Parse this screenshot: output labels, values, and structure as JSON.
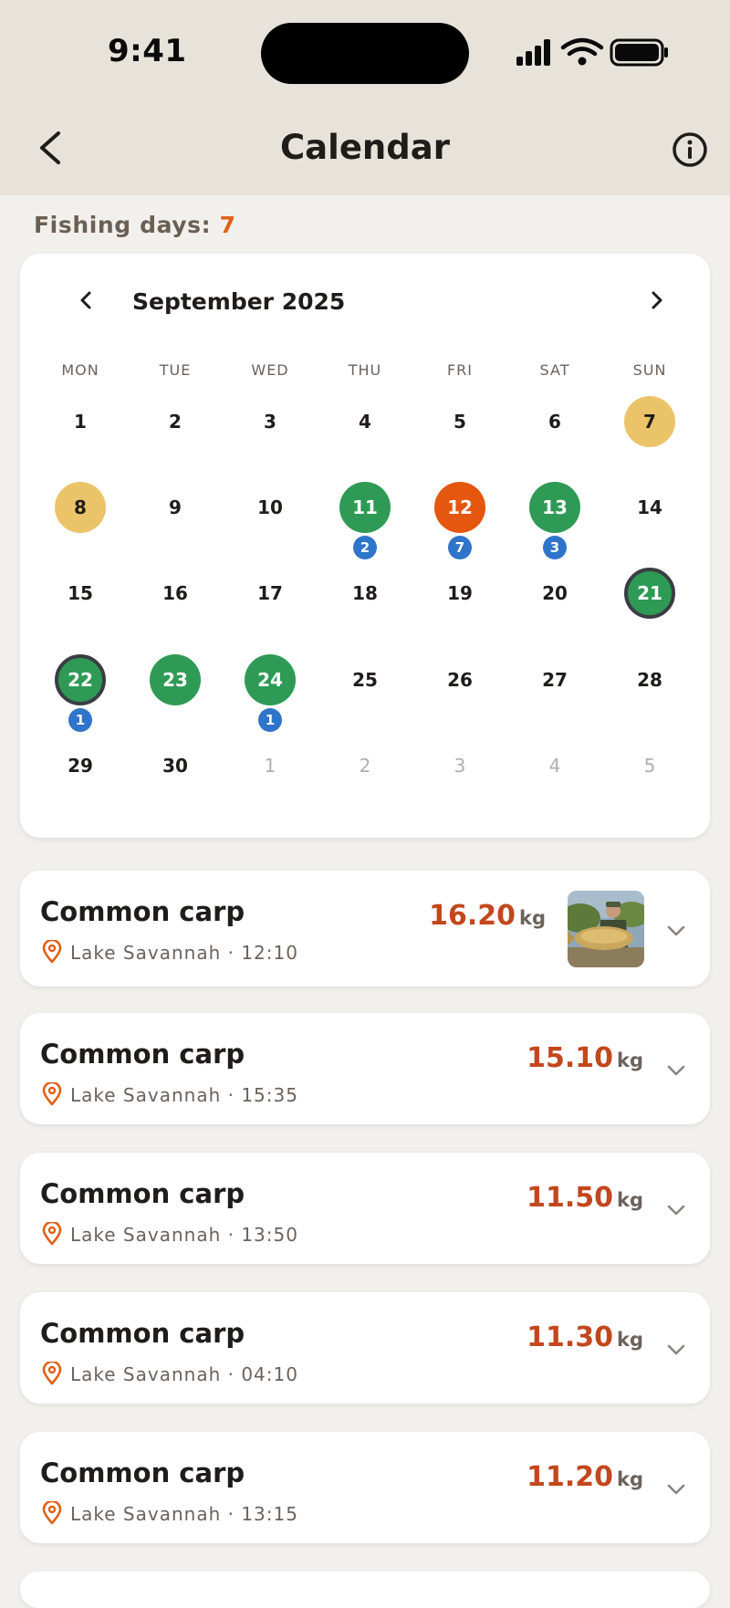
{
  "status": {
    "time": "9:41"
  },
  "nav": {
    "title": "Calendar"
  },
  "fishing_days": {
    "label": "Fishing days:",
    "count": "7"
  },
  "calendar": {
    "month_label": "September 2025",
    "weekdays": [
      "MON",
      "TUE",
      "WED",
      "THU",
      "FRI",
      "SAT",
      "SUN"
    ],
    "weeks": [
      [
        {
          "d": "1"
        },
        {
          "d": "2"
        },
        {
          "d": "3"
        },
        {
          "d": "4"
        },
        {
          "d": "5"
        },
        {
          "d": "6"
        },
        {
          "d": "7",
          "state": "yellow"
        }
      ],
      [
        {
          "d": "8",
          "state": "yellow"
        },
        {
          "d": "9"
        },
        {
          "d": "10"
        },
        {
          "d": "11",
          "state": "green",
          "badge": "2"
        },
        {
          "d": "12",
          "state": "orange",
          "badge": "7"
        },
        {
          "d": "13",
          "state": "green",
          "badge": "3"
        },
        {
          "d": "14"
        }
      ],
      [
        {
          "d": "15"
        },
        {
          "d": "16"
        },
        {
          "d": "17"
        },
        {
          "d": "18"
        },
        {
          "d": "19"
        },
        {
          "d": "20"
        },
        {
          "d": "21",
          "state": "green",
          "ring": true
        }
      ],
      [
        {
          "d": "22",
          "state": "green",
          "ring": true,
          "badge": "1"
        },
        {
          "d": "23",
          "state": "green"
        },
        {
          "d": "24",
          "state": "green",
          "badge": "1"
        },
        {
          "d": "25"
        },
        {
          "d": "26"
        },
        {
          "d": "27"
        },
        {
          "d": "28"
        }
      ],
      [
        {
          "d": "29"
        },
        {
          "d": "30"
        },
        {
          "d": "1",
          "muted": true
        },
        {
          "d": "2",
          "muted": true
        },
        {
          "d": "3",
          "muted": true
        },
        {
          "d": "4",
          "muted": true
        },
        {
          "d": "5",
          "muted": true
        }
      ]
    ]
  },
  "catches": [
    {
      "species": "Common carp",
      "meta": "Lake Savannah · 12:10",
      "weight": "16.20",
      "unit": "kg",
      "has_photo": true
    },
    {
      "species": "Common carp",
      "meta": "Lake Savannah · 15:35",
      "weight": "15.10",
      "unit": "kg"
    },
    {
      "species": "Common carp",
      "meta": "Lake Savannah · 13:50",
      "weight": "11.50",
      "unit": "kg"
    },
    {
      "species": "Common carp",
      "meta": "Lake Savannah · 04:10",
      "weight": "11.30",
      "unit": "kg"
    },
    {
      "species": "Common carp",
      "meta": "Lake Savannah · 13:15",
      "weight": "11.20",
      "unit": "kg"
    }
  ],
  "colors": {
    "header_bg": "#e7e3db",
    "accent_orange": "#e06016",
    "weight_red": "#c3471d",
    "day_green": "#2e9a55",
    "day_yellow": "#ebc46a",
    "day_orange": "#e5560f",
    "badge_blue": "#2e75c9"
  },
  "icons": {
    "back": "chevron-left-icon",
    "info": "info-circle-icon",
    "prev_month": "chevron-left-icon",
    "next_month": "chevron-right-icon",
    "location": "map-pin-icon",
    "expand": "chevron-down-icon"
  }
}
